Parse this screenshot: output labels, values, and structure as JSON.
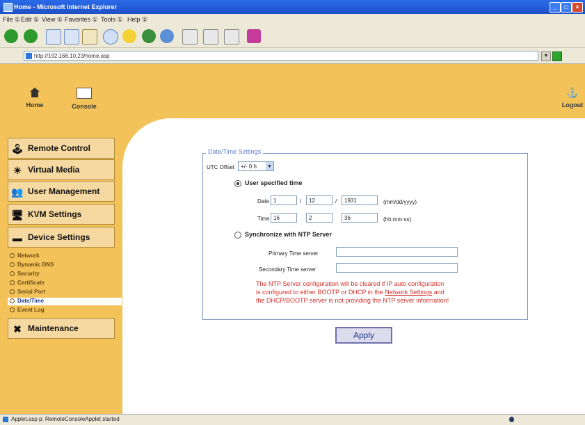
{
  "window": {
    "title": "Home - Microsoft Internet Explorer"
  },
  "menu": {
    "items": [
      "File ①",
      "Edit ①",
      "View ①",
      "Favorites ①",
      "Tools ①",
      "Help ①"
    ]
  },
  "address": {
    "url": "http://192.168.10.23/home.asp"
  },
  "header": {
    "home_label": "Home",
    "console_label": "Console",
    "logout_label": "Logout"
  },
  "sidebar": {
    "items": [
      {
        "label": "Remote Control",
        "icon": "remote-control-icon"
      },
      {
        "label": "Virtual Media",
        "icon": "virtual-media-icon"
      },
      {
        "label": "User Management",
        "icon": "user-management-icon"
      },
      {
        "label": "KVM Settings",
        "icon": "kvm-settings-icon"
      },
      {
        "label": "Device Settings",
        "icon": "device-settings-icon"
      }
    ],
    "subitems": [
      "Network",
      "Dynamic DNS",
      "Security",
      "Certificate",
      "Serial Port",
      "Date/Time",
      "Event Log"
    ],
    "active_subitem": "Date/Time",
    "maintenance": {
      "label": "Maintenance",
      "icon": "maintenance-icon"
    }
  },
  "datetime": {
    "legend": "Date/Time Settings",
    "utc_label": "UTC Offset",
    "utc_value": "+/- 0 h",
    "user_time_label": "User specified time",
    "date_label": "Date",
    "date_month": "1",
    "date_day": "12",
    "date_year": "1931",
    "date_format": "(mm/dd/yyyy)",
    "sep": "/",
    "time_label": "Time",
    "time_h": "16",
    "time_m": "2",
    "time_s": "36",
    "time_format": "(hh:mm:ss)",
    "ntp_label": "Synchronize with NTP Server",
    "primary_label": "Primary Time server",
    "secondary_label": "Secondary Time server",
    "warning_line1": "The NTP Server configuration will be cleared if IP auto configuration",
    "warning_line2a": "is configured to either BOOTP or DHCP in the ",
    "warning_link": "Network Settings",
    "warning_line2b": " and",
    "warning_line3": "the DHCP/BOOTP server is not providing the NTP server information!",
    "apply_label": "Apply"
  },
  "status": {
    "text": "Applet.asp p: RemoteConsoleApplet started"
  },
  "colors": {
    "accent": "#f3c35a",
    "nav_bg": "#f6d9a0",
    "warning": "#d0302a",
    "legend": "#5d7cc8"
  }
}
